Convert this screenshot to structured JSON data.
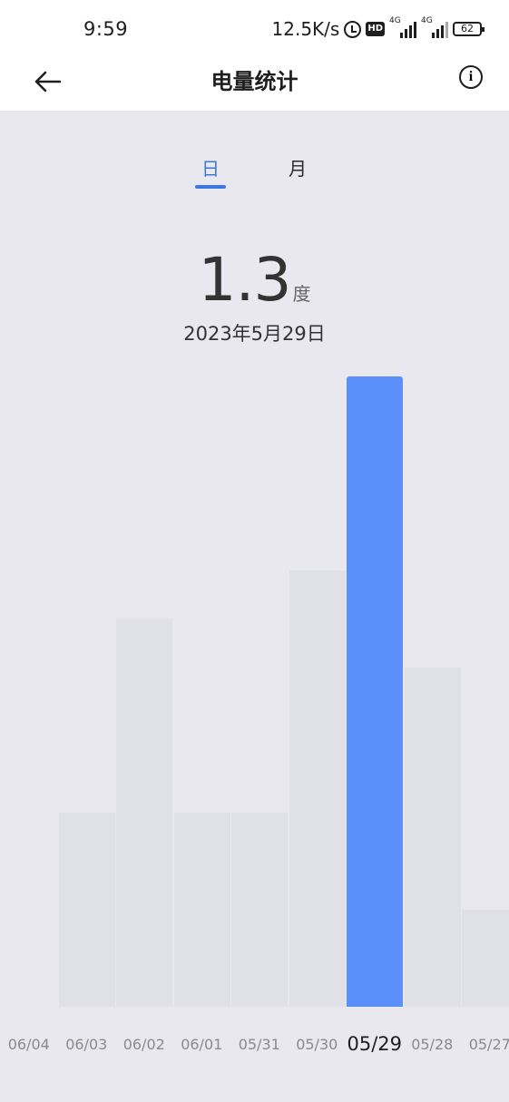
{
  "status_bar": {
    "time": "9:59",
    "net_speed": "12.5K/s",
    "hd_badge": "HD",
    "network_1": "4G",
    "network_2": "4G",
    "battery": "62"
  },
  "header": {
    "title": "电量统计",
    "back_icon": "arrow-left-icon",
    "info_icon": "info-circle-icon"
  },
  "tabs": [
    {
      "label": "日",
      "active": true
    },
    {
      "label": "月",
      "active": false
    }
  ],
  "summary": {
    "value": "1.3",
    "unit": "度",
    "date": "2023年5月29日"
  },
  "colors": {
    "accent": "#3d78e0",
    "bar_selected": "#5b8ffa",
    "bar_default": "#dfe1e6",
    "background": "#e8e8ee"
  },
  "chart_data": {
    "type": "bar",
    "categories": [
      "06/04",
      "06/03",
      "06/02",
      "06/01",
      "05/31",
      "05/30",
      "05/29",
      "05/28",
      "05/27"
    ],
    "values": [
      0,
      0.4,
      0.8,
      0.4,
      0.4,
      0.9,
      1.3,
      0.7,
      0.2
    ],
    "selected": "05/29",
    "ylim": [
      0,
      1.3
    ],
    "grid": false
  }
}
